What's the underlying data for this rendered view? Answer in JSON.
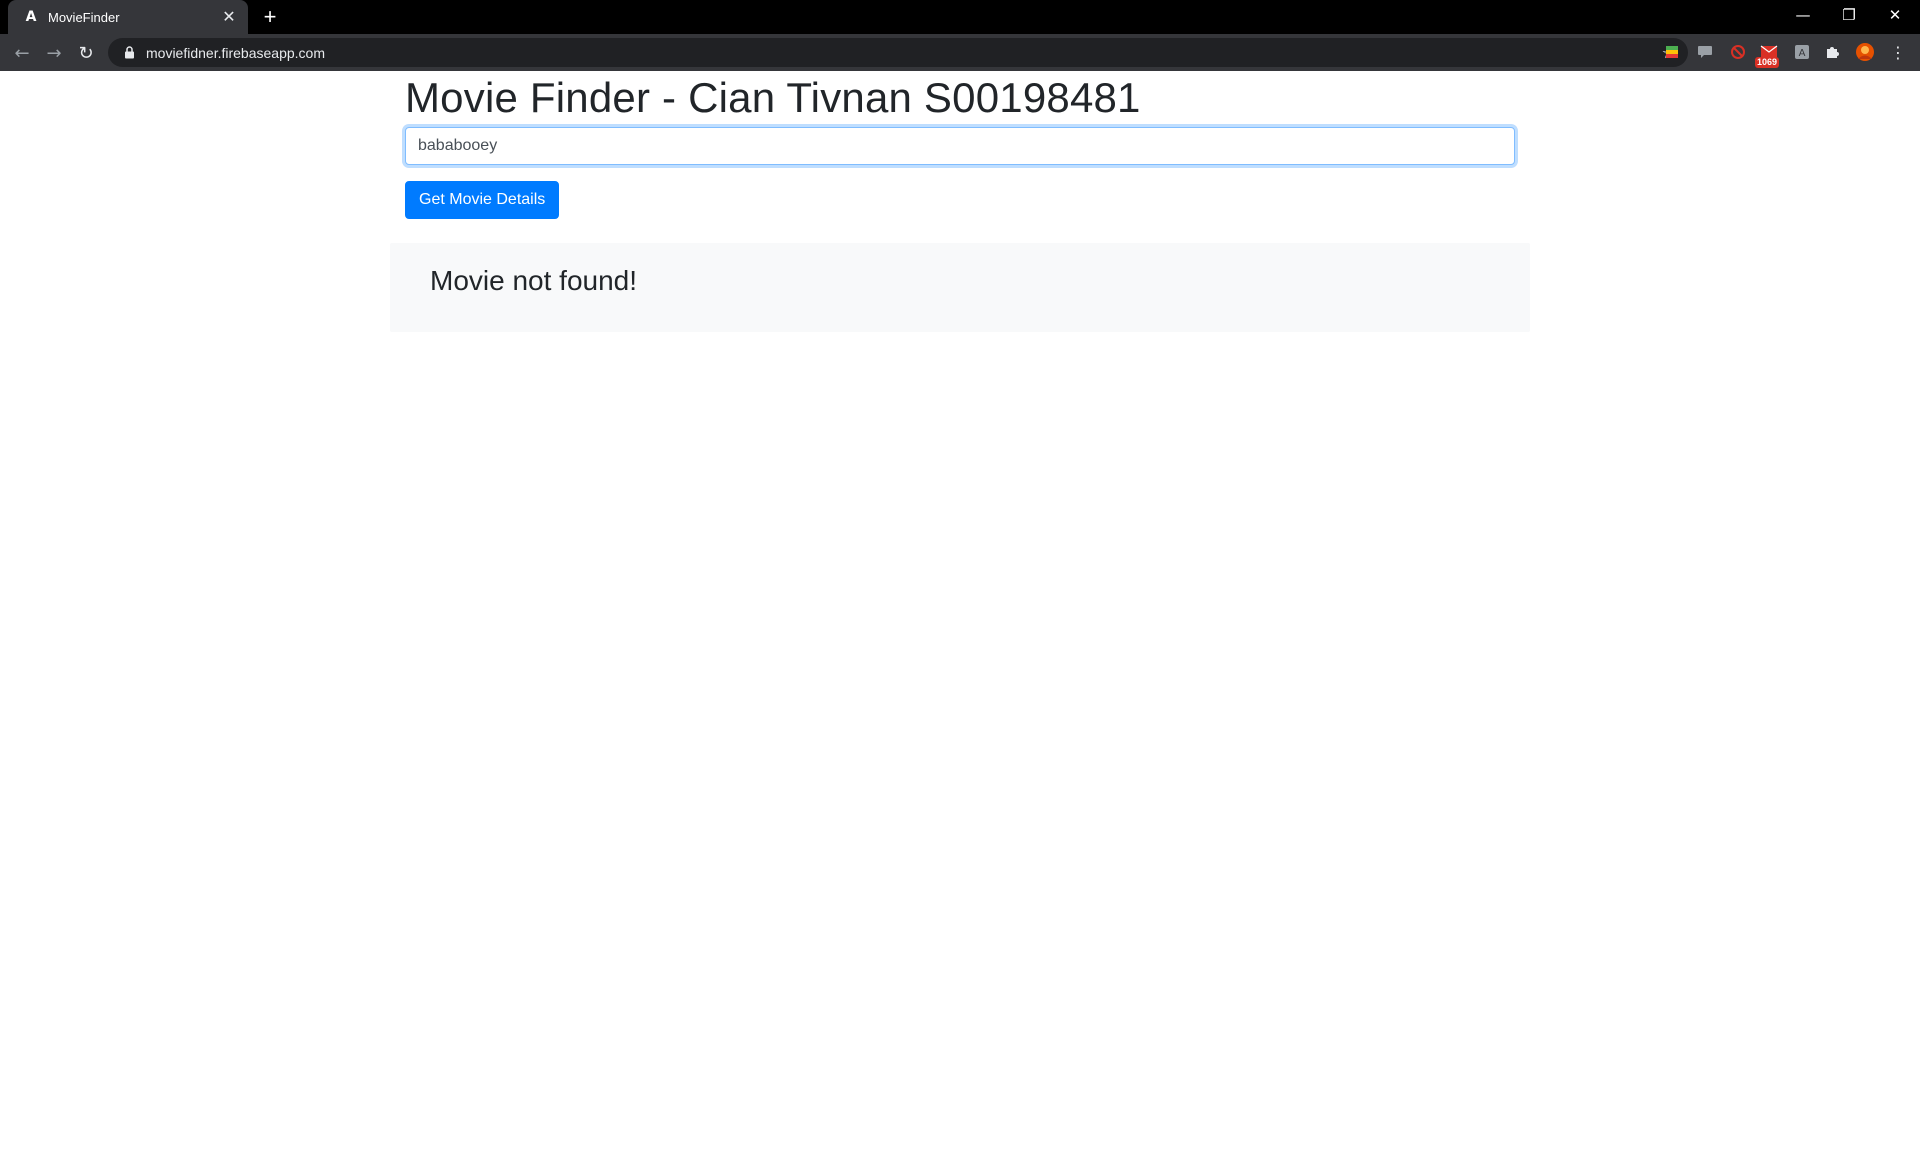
{
  "browser": {
    "tab_title": "MovieFinder",
    "tab_favicon": "A",
    "tab_close": "✕",
    "new_tab": "+",
    "url": "moviefidner.firebaseapp.com",
    "extension_badge": "1069",
    "window_controls": {
      "minimize": "—",
      "restore": "❐",
      "close": "✕"
    },
    "icons": [
      "back-icon",
      "forward-icon",
      "reload-icon",
      "lock-icon",
      "star-icon",
      "extensions-icon",
      "menu-icon"
    ]
  },
  "page": {
    "title": "Movie Finder - Cian Tivnan S00198481",
    "search": {
      "value": "bababooey",
      "placeholder": ""
    },
    "details_button_label": "Get Movie Details",
    "result_message": "Movie not found!"
  },
  "colors": {
    "primary": "#007bff",
    "panel_bg": "#f8f9fa",
    "text": "#212529",
    "focus_border": "#80bdff"
  }
}
